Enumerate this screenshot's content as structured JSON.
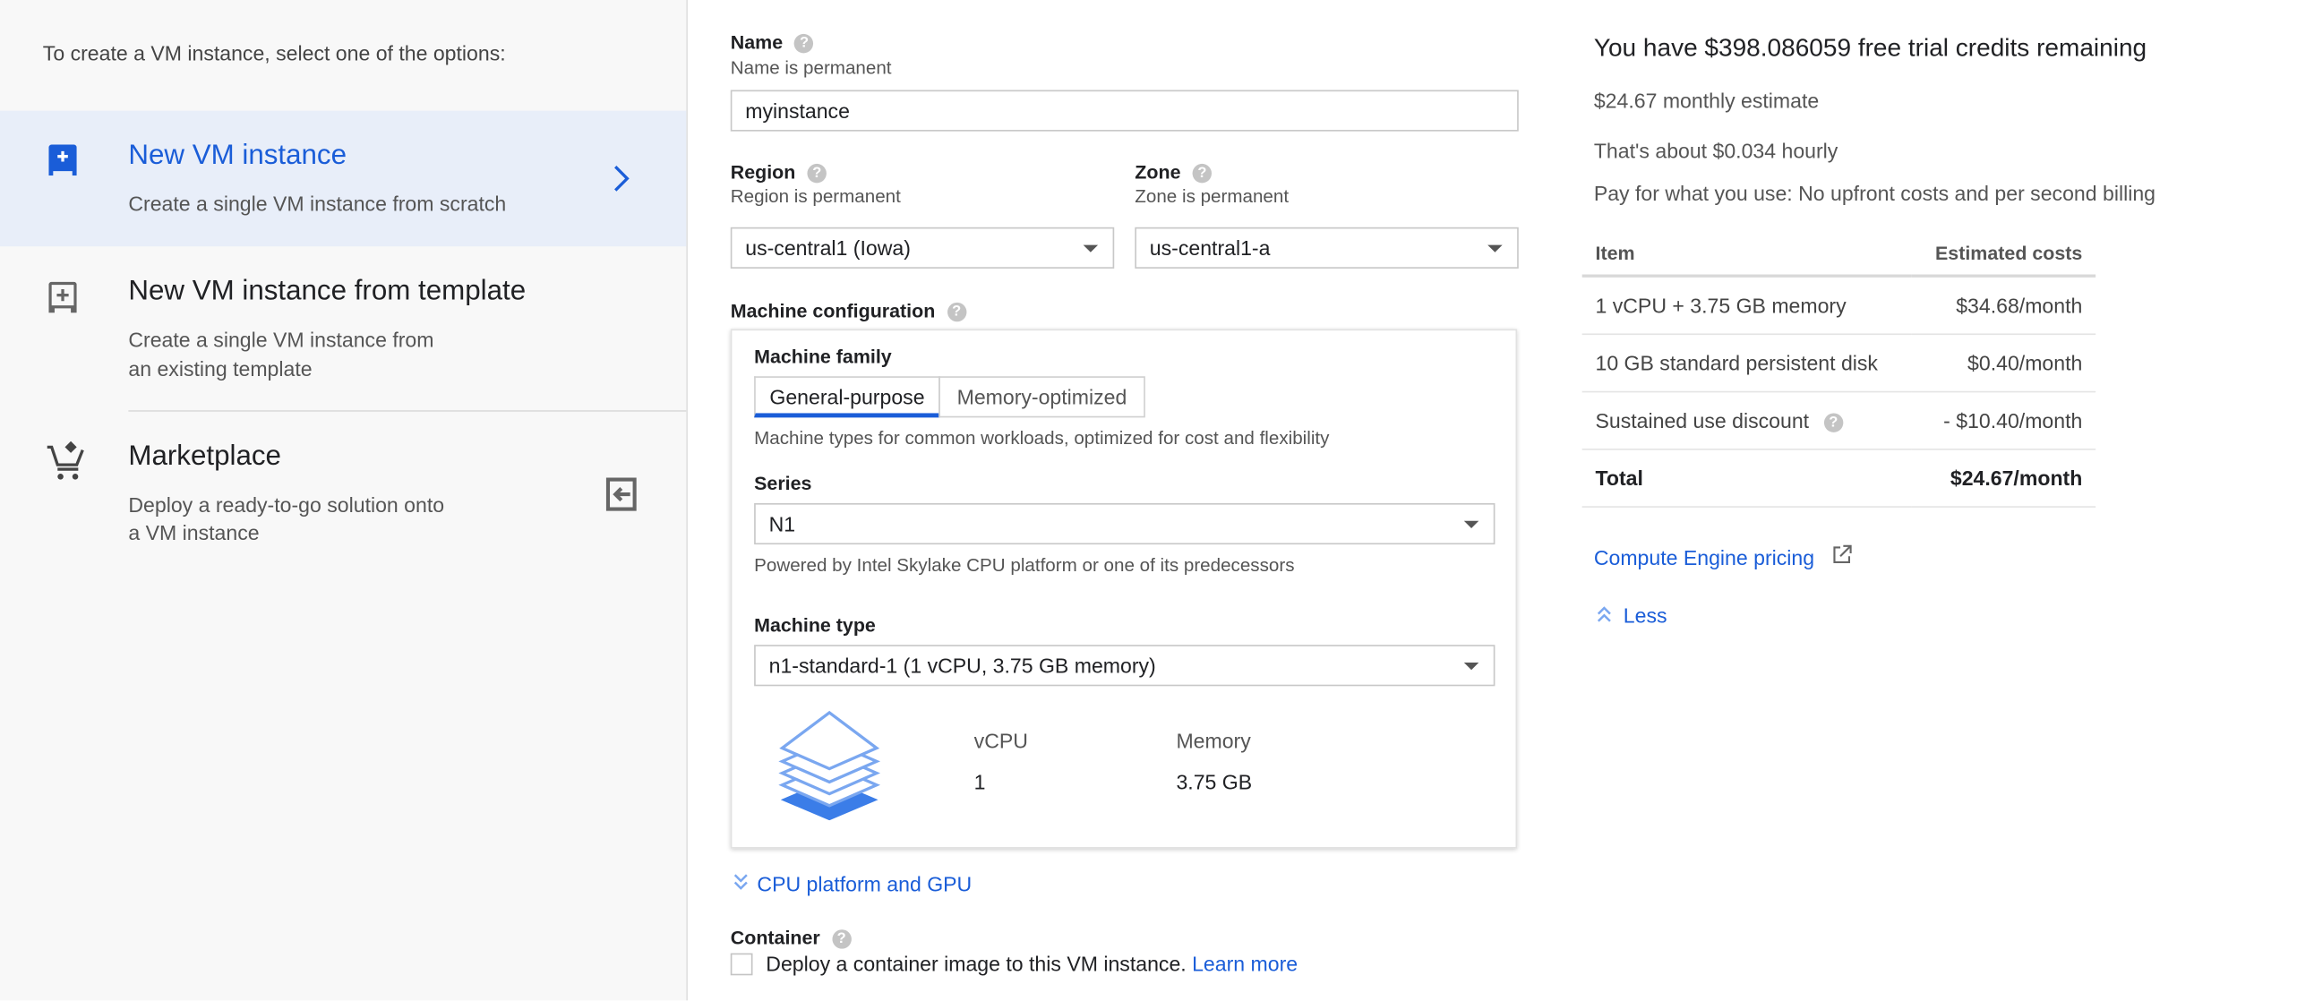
{
  "sidebar": {
    "intro": "To create a VM instance, select one of the options:",
    "options": [
      {
        "title": "New VM instance",
        "desc1": "Create a single VM instance from scratch",
        "icon": "add-vm-icon",
        "selected": true
      },
      {
        "title": "New VM instance from template",
        "desc1": "Create a single VM instance from",
        "desc2": "an existing template",
        "icon": "add-template-icon"
      },
      {
        "title": "Marketplace",
        "desc1": "Deploy a ready-to-go solution onto",
        "desc2": "a VM instance",
        "icon": "marketplace-cart-icon"
      }
    ]
  },
  "form": {
    "name": {
      "label": "Name",
      "hint": "Name is permanent",
      "value": "myinstance"
    },
    "region": {
      "label": "Region",
      "hint": "Region is permanent",
      "value": "us-central1 (Iowa)"
    },
    "zone": {
      "label": "Zone",
      "hint": "Zone is permanent",
      "value": "us-central1-a"
    },
    "machine_config": {
      "label": "Machine configuration",
      "family_label": "Machine family",
      "tabs": [
        "General-purpose",
        "Memory-optimized"
      ],
      "active_tab": 0,
      "family_desc": "Machine types for common workloads, optimized for cost and flexibility",
      "series_label": "Series",
      "series_value": "N1",
      "series_desc": "Powered by Intel Skylake CPU platform or one of its predecessors",
      "type_label": "Machine type",
      "type_value": "n1-standard-1 (1 vCPU, 3.75 GB memory)",
      "vcpu_label": "vCPU",
      "vcpu_value": "1",
      "memory_label": "Memory",
      "memory_value": "3.75 GB"
    },
    "cpu_platform_link": "CPU platform and GPU",
    "container": {
      "label": "Container",
      "checkbox_text": "Deploy a container image to this VM instance.",
      "learn_more": "Learn more",
      "checked": false
    }
  },
  "pricing": {
    "title": "You have $398.086059 free trial credits remaining",
    "monthly": "$24.67 monthly estimate",
    "hourly": "That's about $0.034 hourly",
    "pay": "Pay for what you use: No upfront costs and per second billing",
    "headers": [
      "Item",
      "Estimated costs"
    ],
    "rows": [
      [
        "1 vCPU + 3.75 GB memory",
        "$34.68/month"
      ],
      [
        "10 GB standard persistent disk",
        "$0.40/month"
      ],
      [
        "Sustained use discount",
        "- $10.40/month"
      ]
    ],
    "total": [
      "Total",
      "$24.67/month"
    ],
    "link": "Compute Engine pricing",
    "less": "Less"
  },
  "colors": {
    "accent": "#1a5dd8",
    "selected_bg": "#e8eef9"
  }
}
